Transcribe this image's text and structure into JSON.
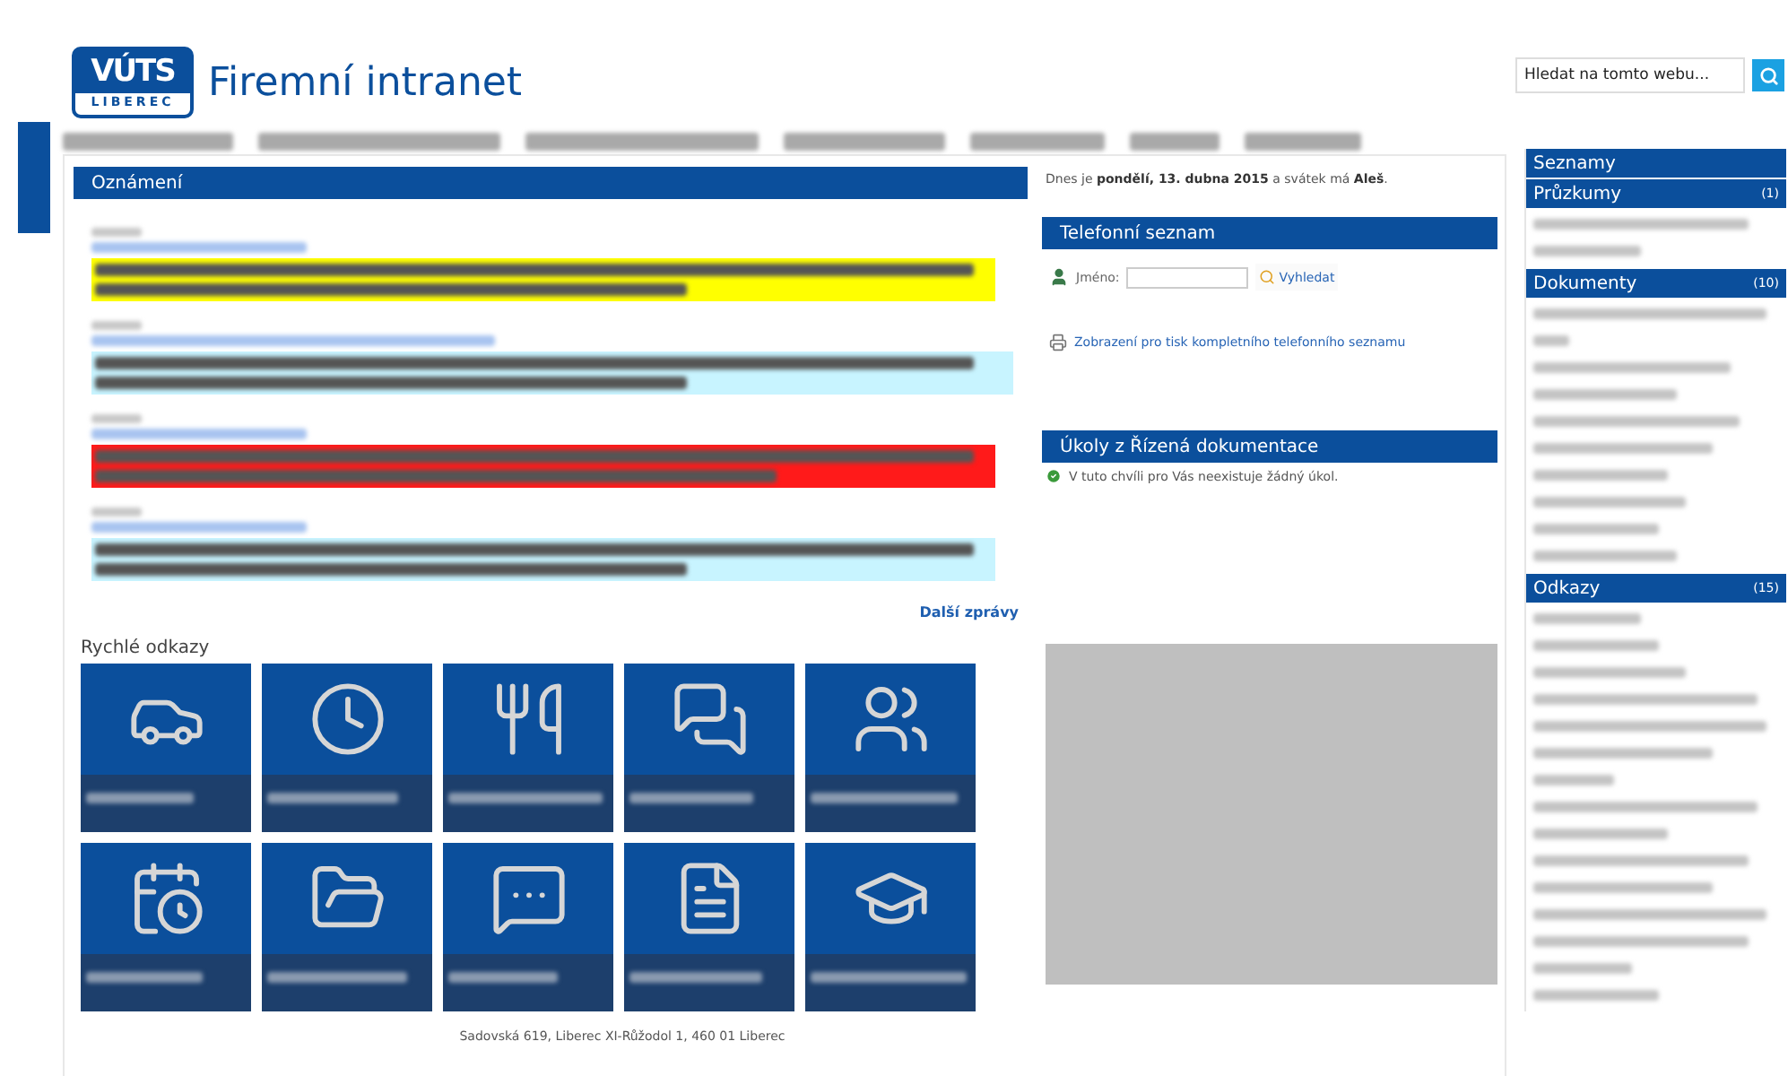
{
  "header": {
    "logo": {
      "main": "VÚTS",
      "sub": "LIBEREC"
    },
    "title": "Firemní intranet",
    "search": {
      "placeholder": "Hledat na tomto webu..."
    }
  },
  "announcements": {
    "title": "Oznámení",
    "items": [
      {
        "color": "#ffff00"
      },
      {
        "color": "#c8f4ff"
      },
      {
        "color": "#ff1a1a"
      },
      {
        "color": "#c8f4ff"
      }
    ],
    "more_link": "Další zprávy"
  },
  "quick_links": {
    "title": "Rychlé odkazy",
    "tiles": [
      {
        "kind": "car"
      },
      {
        "kind": "clock"
      },
      {
        "kind": "cutlery"
      },
      {
        "kind": "discussion"
      },
      {
        "kind": "team"
      },
      {
        "kind": "calendar"
      },
      {
        "kind": "folder"
      },
      {
        "kind": "meeting"
      },
      {
        "kind": "document"
      },
      {
        "kind": "education"
      }
    ]
  },
  "date_line": "Dnes je **pondělí, 13. dubna 2015** a svátek má **Aleš**.",
  "phone_book": {
    "title": "Telefonní seznam",
    "name_label": "Jméno:",
    "search_button": "Vyhledat",
    "print_link": "Zobrazení pro tisk kompletního telefonního seznamu"
  },
  "tasks": {
    "title": "Úkoly z Řízená dokumentace",
    "message": "V tuto chvíli pro Vás neexistuje žádný úkol."
  },
  "sidebar": {
    "title": "Seznamy",
    "sections": [
      {
        "title": "Průzkumy",
        "count": "(1)"
      },
      {
        "title": "Dokumenty",
        "count": "(10)"
      },
      {
        "title": "Odkazy",
        "count": "(15)"
      }
    ]
  },
  "footer": "Sadovská 619, Liberec XI-Růžodol 1, 460 01 Liberec"
}
